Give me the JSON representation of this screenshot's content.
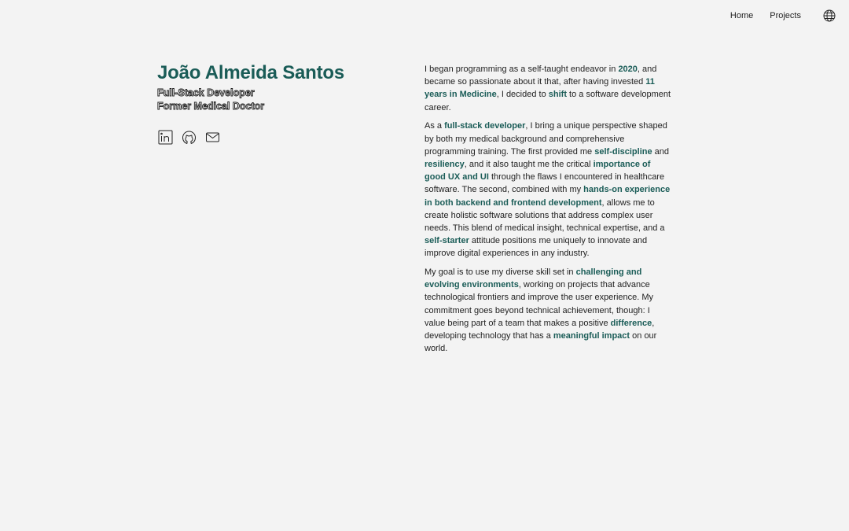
{
  "nav": {
    "home": "Home",
    "projects": "Projects",
    "language_icon": "globe-icon"
  },
  "profile": {
    "name": "João Almeida Santos",
    "role_1": "Full-Stack Developer",
    "role_2": "Former Medical Doctor",
    "socials": [
      "linkedin-icon",
      "github-icon",
      "mail-icon"
    ]
  },
  "colors": {
    "accent": "#1a5c57",
    "background": "#f3f3f3",
    "text": "#222222"
  },
  "about": {
    "p1": {
      "t1": "I began programming as a self-taught endeavor in ",
      "h1": "2020",
      "t2": ", and became so passionate about it that, after having invested ",
      "h2": "11 years in Medicine",
      "t3": ", I decided to ",
      "h3": "shift",
      "t4": " to a software development career."
    },
    "p2": {
      "t1": "As a ",
      "h1": "full-stack developer",
      "t2": ", I bring a unique perspective shaped by both my medical background and comprehensive programming training. The first provided me ",
      "h2": "self-discipline",
      "t3": " and ",
      "h3": "resiliency",
      "t4": ", and it also taught me the critical ",
      "h4": "importance of good UX and UI",
      "t5": " through the flaws I encountered in healthcare software. The second, combined with my ",
      "h5": "hands-on experience in both backend and frontend development",
      "t6": ", allows me to create holistic software solutions that address complex user needs. This blend of medical insight, technical expertise, and a ",
      "h6": "self-starter",
      "t7": " attitude positions me uniquely to innovate and improve digital experiences in any industry."
    },
    "p3": {
      "t1": "My goal is to use my diverse skill set in ",
      "h1": "challenging and evolving environments",
      "t2": ", working on projects that advance technological frontiers and improve the user experience. My commitment goes beyond technical achievement, though: I value being part of a team that makes a positive ",
      "h2": "difference",
      "t3": ", developing technology that has a ",
      "h3": "meaningful impact",
      "t4": " on our world."
    }
  }
}
